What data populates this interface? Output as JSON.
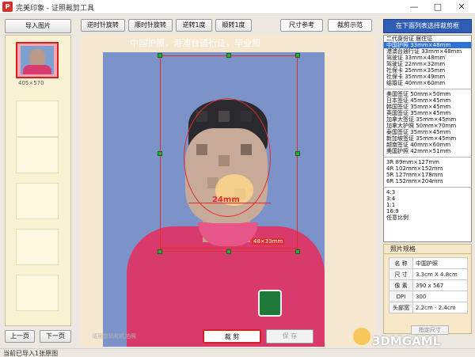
{
  "window": {
    "title": "完美印象 - 证照裁剪工具",
    "logo": "P",
    "minimize": "—",
    "maximize": "□",
    "close": "✕"
  },
  "left": {
    "import_label": "导入图片",
    "thumb_caption": "405×570",
    "prev_label": "上一页",
    "next_label": "下一页"
  },
  "toolbar": {
    "rotate_ccw_label": "逆时针旋转",
    "rotate_cw_label": "顺时针旋转",
    "rotate_ccw_1_label": "逆转1度",
    "rotate_cw_1_label": "顺转1度",
    "size_ref_label": "尺寸参考",
    "crop_demo_label": "裁剪示范"
  },
  "photo": {
    "title": "中国护照，港澳台通行证，毕业照",
    "measure_head": "24mm",
    "measure_chin": "48×33mm",
    "watermark": "请用数码相机拍照"
  },
  "actions": {
    "crop_label": "裁 剪",
    "save_label": "保 存"
  },
  "right": {
    "title": "在下面列表选择裁剪框",
    "group1": [
      "二代身份证 居住证",
      "中国护照 33mm×48mm",
      "港澳台通行证 33mm×48mm",
      "驾驶证 33mm×48mm",
      "驾驶证 22mm×32mm",
      "社保卡 25mm×35mm",
      "社保卡 35mm×49mm",
      "结婚证 40mm×60mm"
    ],
    "selected_index": 1,
    "group2": [
      "美国签证 50mm×50mm",
      "日本签证 45mm×45mm",
      "韩国签证 35mm×45mm",
      "英国签证 35mm×45mm",
      "加拿大签证 35mm×45mm",
      "加拿大护照 50mm×70mm",
      "泰国签证 35mm×45mm",
      "新加坡签证 35mm×45mm",
      "越南签证 40mm×60mm",
      "美国护照 42mm×51mm"
    ],
    "group3": [
      "3R 89mm×127mm",
      "4R 102mm×152mm",
      "5R 127mm×178mm",
      "6R 152mm×204mm"
    ],
    "group4": [
      "4:3",
      "3:4",
      "1:1",
      "16:9",
      "任意比例"
    ]
  },
  "spec": {
    "header": "照片规格",
    "rows": [
      {
        "k": "名 称",
        "v": "中国护照"
      },
      {
        "k": "尺 寸",
        "v": "3.3cm X 4.8cm"
      },
      {
        "k": "像 素",
        "v": "390 x 567"
      },
      {
        "k": "DPI",
        "v": "300"
      },
      {
        "k": "头部宽",
        "v": "2.2cm - 2.4cm"
      }
    ],
    "custom_label": "指定尺寸"
  },
  "status": {
    "text": "当前已导入1张原图"
  },
  "watermark": {
    "site": "3DMGAML"
  },
  "colors": {
    "accent": "#2f5db4",
    "selection": "#2f6fd8",
    "crop": "#e12b2b",
    "handle": "#2fa83a"
  }
}
